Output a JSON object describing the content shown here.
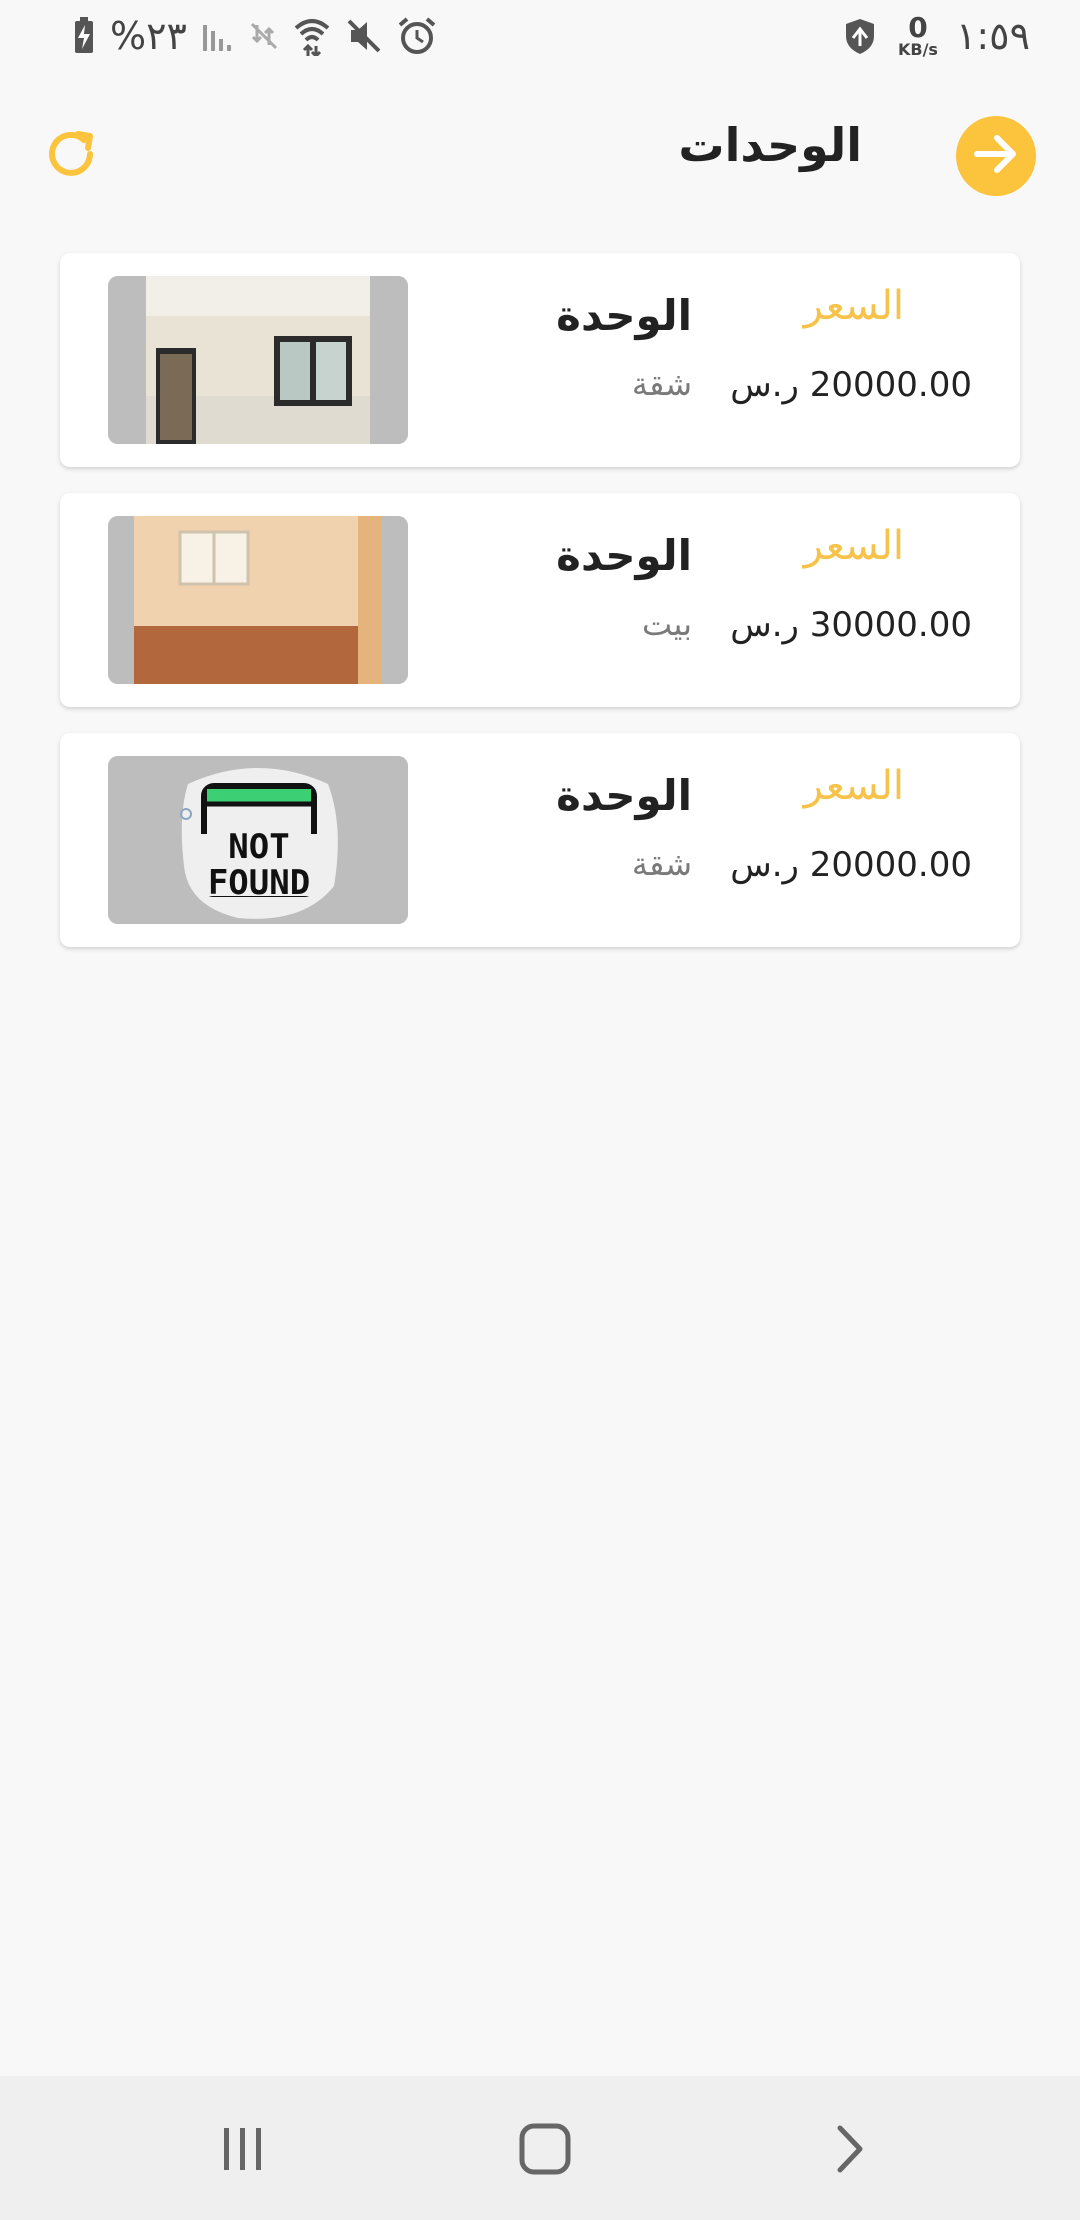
{
  "status_bar": {
    "time": "١:٥٩",
    "net_speed_value": "0",
    "net_speed_unit": "KB/s",
    "battery_percent": "%٢٣"
  },
  "header": {
    "title": "الوحدات"
  },
  "colors": {
    "accent": "#fcc43c",
    "price_label": "#f6c24a",
    "background": "#f8f8f8"
  },
  "units": [
    {
      "title": "الوحدة",
      "type": "شقة",
      "price_label": "السعر",
      "price": "20000.00 ر.س",
      "image": "room-photo-1"
    },
    {
      "title": "الوحدة",
      "type": "بيت",
      "price_label": "السعر",
      "price": "30000.00 ر.س",
      "image": "room-photo-2"
    },
    {
      "title": "الوحدة",
      "type": "شقة",
      "price_label": "السعر",
      "price": "20000.00 ر.س",
      "image": "not-found-image"
    }
  ],
  "not_found_image": {
    "line1": "NOT",
    "line2": "FOUND"
  },
  "icons": [
    "refresh-icon",
    "arrow-right-icon",
    "recents-icon",
    "home-icon",
    "back-icon"
  ]
}
